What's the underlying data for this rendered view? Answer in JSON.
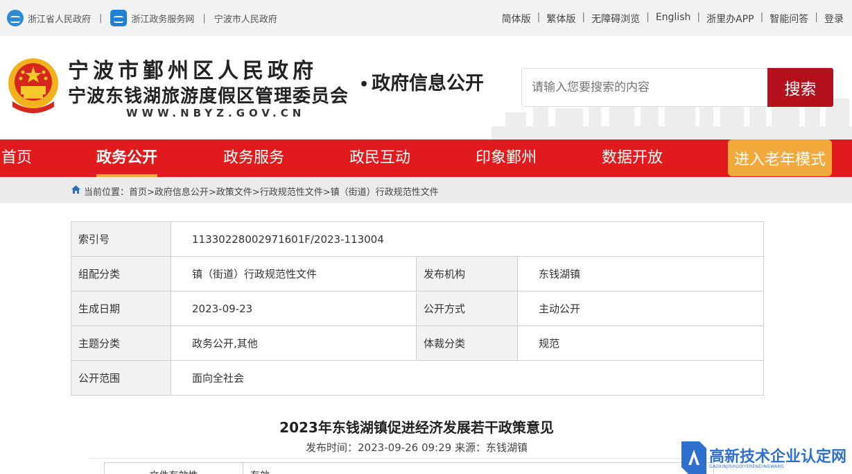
{
  "topbar": {
    "left_links": [
      "浙江省人民政府",
      "浙江政务服务网",
      "宁波市人民政府"
    ],
    "right_links": [
      "简体版",
      "繁体版",
      "无障碍浏览",
      "English",
      "浙里办APP",
      "智能问答",
      "登录"
    ]
  },
  "header": {
    "title_line1": "宁波市鄞州区人民政府",
    "title_line2": "宁波东钱湖旅游度假区管理委员会",
    "domain": "WWW.NBYZ.GOV.CN",
    "subtitle_dot": "•",
    "subtitle": "政府信息公开",
    "search_placeholder": "请输入您要搜索的内容",
    "search_button": "搜索"
  },
  "nav": {
    "items": [
      "首页",
      "政务公开",
      "政务服务",
      "政民互动",
      "印象鄞州",
      "数据开放"
    ],
    "active": "政务公开",
    "elder_mode": "进入老年模式"
  },
  "breadcrumb": {
    "label": "当前位置：",
    "path": "首页>政府信息公开>政策文件>行政规范性文件>镇（街道）行政规范性文件"
  },
  "info": {
    "index_label": "索引号",
    "index_value": "11330228002971601F/2023-113004",
    "category_label": "组配分类",
    "category_value": "镇（街道）行政规范性文件",
    "publisher_label": "发布机构",
    "publisher_value": "东钱湖镇",
    "date_label": "生成日期",
    "date_value": "2023-09-23",
    "method_label": "公开方式",
    "method_value": "主动公开",
    "topic_label": "主题分类",
    "topic_value": "政务公开,其他",
    "genre_label": "体裁分类",
    "genre_value": "规范",
    "scope_label": "公开范围",
    "scope_value": "面向全社会"
  },
  "article": {
    "title": "2023年东钱湖镇促进经济发展若干政策意见",
    "published_label": "发布时间：",
    "published_value": "2023-09-26 09:29",
    "source_label": "来源：",
    "source_value": "东钱湖镇",
    "validity_label": "文件有效性",
    "validity_value": "有效"
  },
  "watermark": {
    "title": "高新技术企业认定网",
    "pinyin": "GAOXINJISHUQIYERENDINGWANG"
  },
  "colors": {
    "nav_red": "#e11b1d",
    "search_red": "#b5111d",
    "elder_orange": "#f2a93b",
    "watermark_blue": "#2f6fce"
  }
}
